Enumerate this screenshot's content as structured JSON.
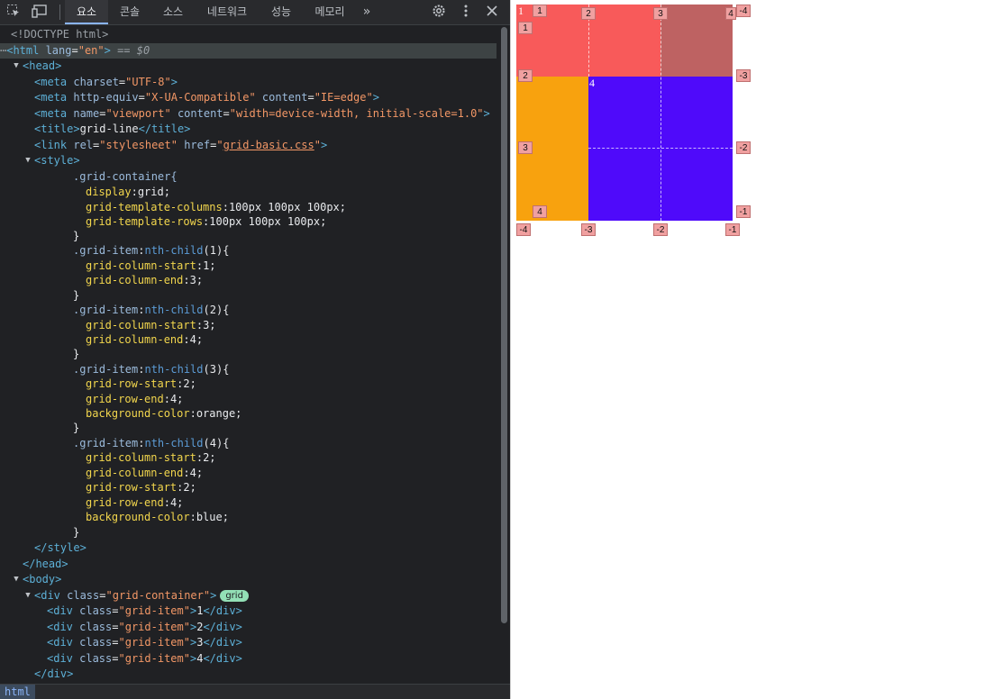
{
  "toolbar": {
    "icons": [
      "inspect-icon",
      "device-toggle-icon"
    ],
    "tabs": [
      "요소",
      "콘솔",
      "소스",
      "네트워크",
      "성능",
      "메모리"
    ],
    "active_tab": "요소",
    "more": "»",
    "right_icons": [
      "settings-gear-icon",
      "more-vertical-icon",
      "close-icon"
    ]
  },
  "code": {
    "doctype": "<!DOCTYPE html>",
    "html_open_tag": "<html",
    "html_lang_attr": " lang",
    "html_lang_val": "\"en\"",
    "html_close": ">",
    "eq": " == ",
    "dollar": "$0",
    "head_open": "<head>",
    "meta1": {
      "tag": "<meta",
      "a1": " charset",
      "v1": "\"UTF-8\"",
      "end": ">"
    },
    "meta2": {
      "tag": "<meta",
      "a1": " http-equiv",
      "v1": "\"X-UA-Compatible\"",
      "a2": " content",
      "v2": "\"IE=edge\"",
      "end": ">"
    },
    "meta3": {
      "tag": "<meta",
      "a1": " name",
      "v1": "\"viewport\"",
      "a2": " content",
      "v2": "\"width=device-width, initial-scale=1.0\"",
      "end": ">"
    },
    "title": {
      "open": "<title>",
      "text": "grid-line",
      "close": "</title>"
    },
    "link": {
      "tag": "<link",
      "a1": " rel",
      "v1": "\"stylesheet\"",
      "a2": " href",
      "v2q1": "\"",
      "v2": "grid-basic.css",
      "v2q2": "\"",
      "end": ">"
    },
    "style_open": "<style>",
    "css": {
      "r0_sel": ".grid-container{",
      "r0_p1": "display",
      "r0_v1": "grid;",
      "r0_p2": "grid-template-columns",
      "r0_v2": "100px 100px 100px;",
      "r0_p3": "grid-template-rows",
      "r0_v3": "100px 100px 100px;",
      "close": "}",
      "item_sel": ".grid-item",
      "colon": ":",
      "r1_pseudo": "nth-child",
      "r1_arg": "(1){",
      "r1_p1": "grid-column-start",
      "r1_v1": "1;",
      "r1_p2": "grid-column-end",
      "r1_v2": "3;",
      "r2_pseudo": "nth-child",
      "r2_arg": "(2){",
      "r2_p1": "grid-column-start",
      "r2_v1": "3;",
      "r2_p2": "grid-column-end",
      "r2_v2": "4;",
      "r3_pseudo": "nth-child",
      "r3_arg": "(3){",
      "r3_p1": "grid-row-start",
      "r3_v1": "2;",
      "r3_p2": "grid-row-end",
      "r3_v2": "4;",
      "r3_p3": "background-color",
      "r3_v3": "orange;",
      "r4_pseudo": "nth-child",
      "r4_arg": "(4){",
      "r4_p1": "grid-column-start",
      "r4_v1": "2;",
      "r4_p2": "grid-column-end",
      "r4_v2": "4;",
      "r4_p3": "grid-row-start",
      "r4_v3": "2;",
      "r4_p4": "grid-row-end",
      "r4_v4": "4;",
      "r4_p5": "background-color",
      "r4_v5": "blue;"
    },
    "style_close": "</style>",
    "head_close": "</head>",
    "body_open": "<body>",
    "div_container": {
      "tag": "<div",
      "a1": " class",
      "v1": "\"grid-container\"",
      "end": ">",
      "badge": "grid"
    },
    "items": [
      {
        "tag": "<div",
        "a": " class",
        "v": "\"grid-item\"",
        "gt": ">",
        "text": "1",
        "close": "</div>"
      },
      {
        "tag": "<div",
        "a": " class",
        "v": "\"grid-item\"",
        "gt": ">",
        "text": "2",
        "close": "</div>"
      },
      {
        "tag": "<div",
        "a": " class",
        "v": "\"grid-item\"",
        "gt": ">",
        "text": "3",
        "close": "</div>"
      },
      {
        "tag": "<div",
        "a": " class",
        "v": "\"grid-item\"",
        "gt": ">",
        "text": "4",
        "close": "</div>"
      }
    ],
    "div_close": "</div>"
  },
  "breadcrumb": "html",
  "rendered": {
    "item1_text": "1",
    "item4_text": "4",
    "colors": {
      "item1": "#f85a5a",
      "item2": "#be6262",
      "item3": "#f8a20e",
      "item4": "#4f0afa"
    },
    "col_badges_top": [
      "1",
      "2",
      "3",
      "4"
    ],
    "col_badges_bottom": [
      "-4",
      "-3",
      "-2",
      "-1"
    ],
    "row_badges_left": [
      "1",
      "2",
      "3",
      "4"
    ],
    "row_badges_right": [
      "-4",
      "-3",
      "-2",
      "-1"
    ]
  }
}
